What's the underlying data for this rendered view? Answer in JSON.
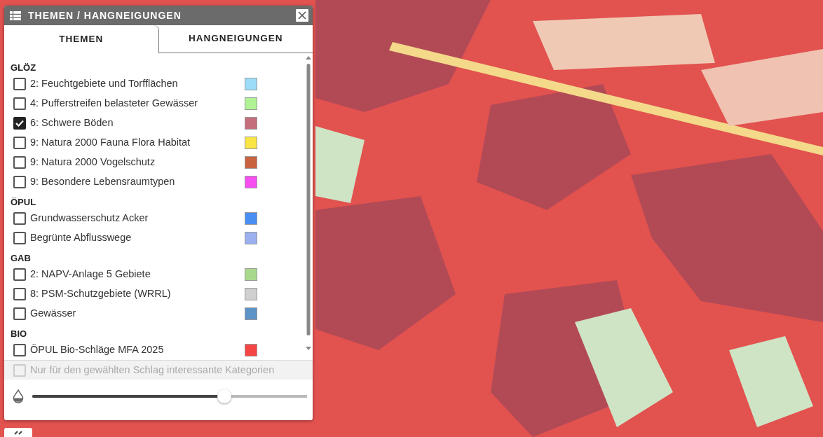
{
  "panel": {
    "title": "THEMEN / HANGNEIGUNGEN",
    "tabs": [
      {
        "label": "THEMEN",
        "selected": true
      },
      {
        "label": "HANGNEIGUNGEN",
        "selected": false
      }
    ],
    "groups": [
      {
        "title": "GLÖZ",
        "items": [
          {
            "label": "2: Feuchtgebiete und Torfflächen",
            "checked": false,
            "color": "#9cdcf8"
          },
          {
            "label": "4: Pufferstreifen belasteter Gewässer",
            "checked": false,
            "color": "#b0f294"
          },
          {
            "label": "6: Schwere Böden",
            "checked": true,
            "color": "#c46e7c"
          },
          {
            "label": "9: Natura 2000 Fauna Flora Habitat",
            "checked": false,
            "color": "#fbe545"
          },
          {
            "label": "9: Natura 2000 Vogelschutz",
            "checked": false,
            "color": "#c9633f"
          },
          {
            "label": "9: Besondere Lebensraumtypen",
            "checked": false,
            "color": "#f54ff0"
          }
        ]
      },
      {
        "title": "ÖPUL",
        "items": [
          {
            "label": "Grundwasserschutz Acker",
            "checked": false,
            "color": "#4a8ef2"
          },
          {
            "label": "Begrünte Abflusswege",
            "checked": false,
            "color": "#9bb0ef"
          }
        ]
      },
      {
        "title": "GAB",
        "items": [
          {
            "label": "2: NAPV-Anlage 5 Gebiete",
            "checked": false,
            "color": "#a8d98c"
          },
          {
            "label": "8: PSM-Schutzgebiete (WRRL)",
            "checked": false,
            "color": "#d0d0d0"
          },
          {
            "label": "Gewässer",
            "checked": false,
            "color": "#5e93c8"
          }
        ]
      },
      {
        "title": "BIO",
        "items": [
          {
            "label": "ÖPUL Bio-Schläge MFA 2025",
            "checked": false,
            "color": "#f64545"
          }
        ]
      }
    ],
    "filter": {
      "label": "Nur für den gewählten Schlag interessante Kategorien",
      "checked": false,
      "disabled": true
    },
    "opacity": {
      "level": 0.7
    }
  }
}
